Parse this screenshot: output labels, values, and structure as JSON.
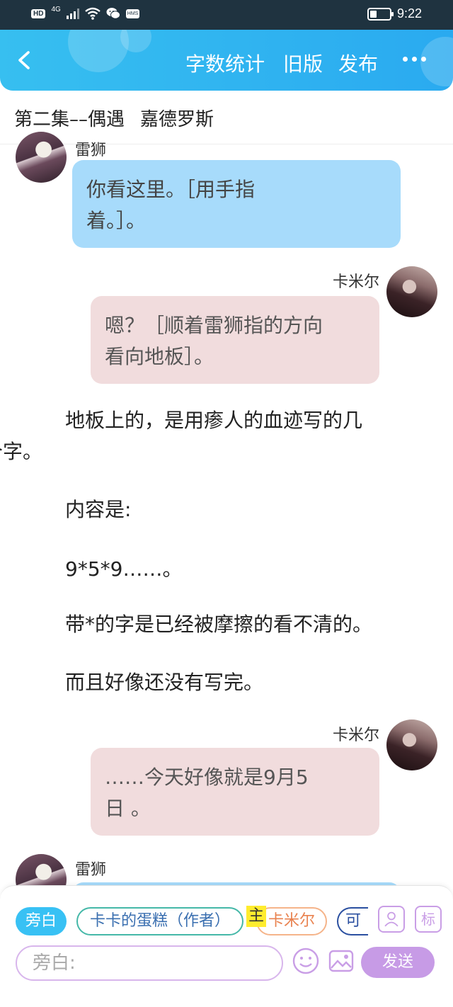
{
  "status_bar": {
    "hd": "HD",
    "network": "4G",
    "hms": "HMS",
    "time": "9:22"
  },
  "header": {
    "back_icon": "chevron-left-icon",
    "word_count": "字数统计",
    "old_version": "旧版",
    "publish": "发布",
    "more_icon": "more-dots-icon"
  },
  "chapter": {
    "episode": "第二集––偶遇",
    "name": "嘉德罗斯"
  },
  "messages": {
    "m1": {
      "speaker": "雷狮",
      "line1": "你看这里。［用手指",
      "line2": "着。］。"
    },
    "m2": {
      "speaker": "卡米尔",
      "line1": "嗯？［顺着雷狮指的方向",
      "line2": "看向地板］。"
    },
    "n1": {
      "line1": "地板上的，是用瘆人的血迹写的几",
      "line2": "个字。"
    },
    "n2": "内容是:",
    "n3": "9*5*9……。",
    "n4": "带*的字是已经被摩擦的看不清的。",
    "n5": "而且好像还没有写完。",
    "m3": {
      "speaker": "卡米尔",
      "line1": "……今天好像就是9月5",
      "line2": "日 。"
    },
    "m4": {
      "speaker": "雷狮"
    }
  },
  "composer": {
    "chip_narration": "旁白",
    "chip_author": "卡卡的蛋糕（作者）",
    "chip_main_mark": "主",
    "chip_kamier": "卡米尔",
    "chip_more": "可",
    "tag_button": "标",
    "input_placeholder": "旁白:",
    "send": "发送"
  },
  "colors": {
    "header": "#2aaaf0",
    "bubble_left": "#a7dbfb",
    "bubble_right": "#f1dcdd",
    "send": "#c79be6"
  }
}
